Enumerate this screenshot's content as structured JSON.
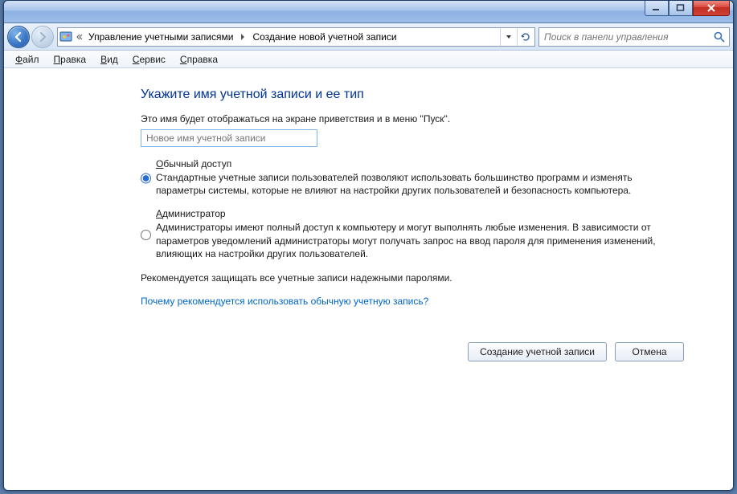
{
  "titlebar": {},
  "nav": {
    "breadcrumb": {
      "seg1": "Управление учетными записями",
      "seg2": "Создание новой учетной записи"
    },
    "search_placeholder": "Поиск в панели управления"
  },
  "menu": {
    "file": "Файл",
    "edit": "Правка",
    "view": "Вид",
    "tools": "Сервис",
    "help": "Справка"
  },
  "page": {
    "title": "Укажите имя учетной записи и ее тип",
    "subtitle": "Это имя будет отображаться на экране приветствия и в меню \"Пуск\".",
    "name_placeholder": "Новое имя учетной записи",
    "options": {
      "standard": {
        "label": "Обычный доступ",
        "desc": "Стандартные учетные записи пользователей позволяют использовать большинство программ и изменять параметры системы, которые не влияют на настройки других пользователей и безопасность компьютера."
      },
      "admin": {
        "label": "Администратор",
        "desc": "Администраторы имеют полный доступ к компьютеру и могут выполнять любые изменения. В зависимости от параметров уведомлений администраторы могут получать запрос на ввод пароля для применения изменений, влияющих на настройки других пользователей."
      }
    },
    "note": "Рекомендуется защищать все учетные записи надежными паролями.",
    "help_link": "Почему рекомендуется использовать обычную учетную запись?",
    "create_button": "Создание учетной записи",
    "cancel_button": "Отмена"
  }
}
